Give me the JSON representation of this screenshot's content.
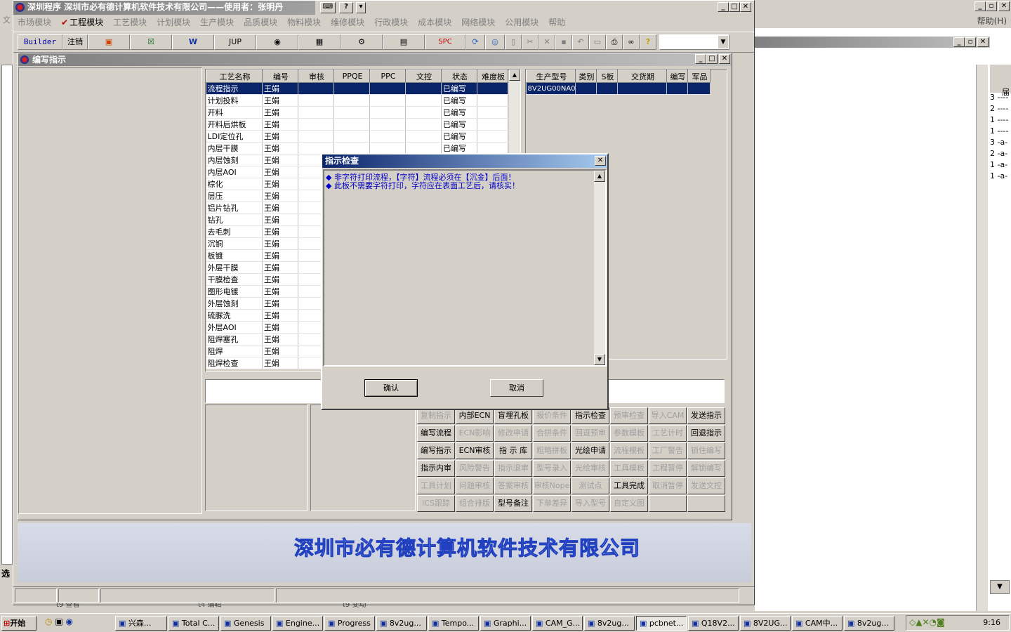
{
  "app": {
    "title": "深圳程序    深圳市必有德计算机软件技术有限公司——使用者：张明丹"
  },
  "menu": [
    "市场模块",
    "工程模块",
    "工艺模块",
    "计划模块",
    "生产模块",
    "品质模块",
    "物料模块",
    "维修模块",
    "行政模块",
    "成本模块",
    "网络模块",
    "公用模块",
    "帮助"
  ],
  "menu_left_fragment": "文",
  "right_menu": "帮助(H)",
  "toolbar": {
    "builder": "Builder",
    "logout": "注销",
    "jup": "JUP",
    "spc": "SPC"
  },
  "child": {
    "title": "编写指示"
  },
  "process_grid": {
    "headers": [
      "工艺名称",
      "编号",
      "审核",
      "PPQE",
      "PPC",
      "文控",
      "状态",
      "难度板"
    ],
    "rows": [
      [
        "流程指示",
        "王娟",
        "",
        "",
        "",
        "",
        "已编写",
        ""
      ],
      [
        "计划投料",
        "王娟",
        "",
        "",
        "",
        "",
        "已编写",
        ""
      ],
      [
        "开料",
        "王娟",
        "",
        "",
        "",
        "",
        "已编写",
        ""
      ],
      [
        "开料后烘板",
        "王娟",
        "",
        "",
        "",
        "",
        "已编写",
        ""
      ],
      [
        "LDI定位孔",
        "王娟",
        "",
        "",
        "",
        "",
        "已编写",
        ""
      ],
      [
        "内层干膜",
        "王娟",
        "",
        "",
        "",
        "",
        "已编写",
        ""
      ],
      [
        "内层蚀刻",
        "王娟",
        "",
        "",
        "",
        "",
        "",
        ""
      ],
      [
        "内层AOI",
        "王娟",
        "",
        "",
        "",
        "",
        "",
        ""
      ],
      [
        "棕化",
        "王娟",
        "",
        "",
        "",
        "",
        "",
        ""
      ],
      [
        "层压",
        "王娟",
        "",
        "",
        "",
        "",
        "",
        ""
      ],
      [
        "铝片钻孔",
        "王娟",
        "",
        "",
        "",
        "",
        "",
        ""
      ],
      [
        "钻孔",
        "王娟",
        "",
        "",
        "",
        "",
        "",
        ""
      ],
      [
        "去毛刺",
        "王娟",
        "",
        "",
        "",
        "",
        "",
        ""
      ],
      [
        "沉铜",
        "王娟",
        "",
        "",
        "",
        "",
        "",
        ""
      ],
      [
        "板镀",
        "王娟",
        "",
        "",
        "",
        "",
        "",
        ""
      ],
      [
        "外层干膜",
        "王娟",
        "",
        "",
        "",
        "",
        "",
        ""
      ],
      [
        "干膜检查",
        "王娟",
        "",
        "",
        "",
        "",
        "",
        ""
      ],
      [
        "图形电镀",
        "王娟",
        "",
        "",
        "",
        "",
        "",
        ""
      ],
      [
        "外层蚀刻",
        "王娟",
        "",
        "",
        "",
        "",
        "",
        ""
      ],
      [
        "硫脲洗",
        "王娟",
        "",
        "",
        "",
        "",
        "",
        ""
      ],
      [
        "外层AOI",
        "王娟",
        "",
        "",
        "",
        "",
        "",
        ""
      ],
      [
        "阻焊塞孔",
        "王娟",
        "",
        "",
        "",
        "",
        "",
        ""
      ],
      [
        "阻焊",
        "王娟",
        "",
        "",
        "",
        "",
        "",
        ""
      ],
      [
        "阻焊检查",
        "王娟",
        "",
        "",
        "",
        "",
        "",
        ""
      ]
    ]
  },
  "model_grid": {
    "headers": [
      "生产型号",
      "类别",
      "S板",
      "交货期",
      "编写",
      "军品"
    ],
    "rows": [
      [
        "8V2UG00NA0",
        "",
        "",
        "",
        "",
        ""
      ]
    ]
  },
  "buttons": [
    [
      "复制指示",
      "内部ECN",
      "盲埋孔板",
      "报价条件",
      "指示检查",
      "预审检查",
      "导入CAM",
      "发送指示"
    ],
    [
      "编写流程",
      "ECN影响",
      "修改申请",
      "合拼条件",
      "回退预审",
      "参数模板",
      "工艺计时",
      "回退指示"
    ],
    [
      "编写指示",
      "ECN审核",
      "指 示 库",
      "粗略拼板",
      "光绘申请",
      "流程模板",
      "工厂警告",
      "锁住编写"
    ],
    [
      "指示内审",
      "风险警告",
      "指示退审",
      "型号录入",
      "光绘审核",
      "工具模板",
      "工程暂停",
      "解锁编写"
    ],
    [
      "工具计划",
      "问题审核",
      "答案审核",
      "审核Nope",
      "测试点",
      "工具完成",
      "取消暂停",
      "发送文控"
    ],
    [
      "ICS跟踪",
      "组合排版",
      "型号备注",
      "下单差异",
      "导入型号",
      "自定义图",
      "",
      ""
    ]
  ],
  "buttons_enabled": [
    [
      false,
      true,
      true,
      false,
      true,
      false,
      false,
      true
    ],
    [
      true,
      false,
      false,
      false,
      false,
      false,
      false,
      true
    ],
    [
      true,
      true,
      true,
      false,
      true,
      false,
      false,
      false
    ],
    [
      true,
      false,
      false,
      false,
      false,
      false,
      false,
      false
    ],
    [
      false,
      false,
      false,
      false,
      false,
      true,
      false,
      false
    ],
    [
      false,
      false,
      true,
      false,
      false,
      false,
      false,
      false
    ]
  ],
  "dialog": {
    "title": "指示检查",
    "messages": [
      "非字符打印流程，【字符】流程必须在【沉金】后面！",
      "此板不需要字符打印，字符应在表面工艺后，请核实！"
    ],
    "ok": "确认",
    "cancel": "取消"
  },
  "company_banner": "深圳市必有德计算机软件技术有限公司",
  "bg_fragments": {
    "col_header": "届",
    "rows": [
      "3 ----",
      "2 ----",
      "1 ----",
      "1 ----",
      "3 -a-",
      "2 -a-",
      "1 -a-",
      "1 -a-"
    ],
    "left_chars": [
      "文",
      "选"
    ],
    "bottom_labels": [
      "t9 查看",
      "t4 编辑",
      "t9 变动"
    ]
  },
  "taskbar": {
    "start": "开始",
    "items": [
      "兴森...",
      "Total C...",
      "Genesis",
      "Engine...",
      "Progress",
      "8v2ug...",
      "Tempo...",
      "Graphi...",
      "CAM_G...",
      "8v2ug...",
      "pcbnet...",
      "Q18V2...",
      "8V2UG...",
      "CAM中...",
      "8v2ug..."
    ],
    "active_index": 10,
    "clock": "9:16"
  }
}
